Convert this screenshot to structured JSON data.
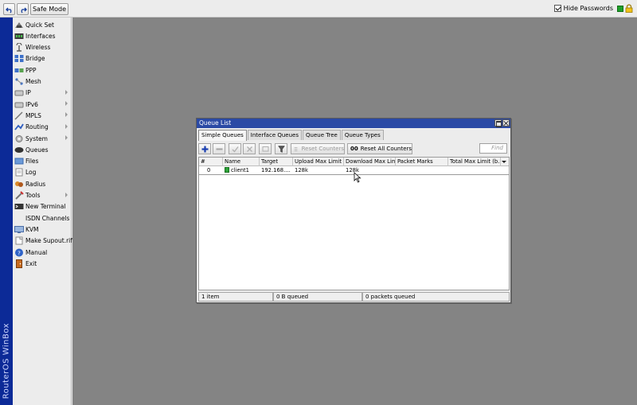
{
  "topbar": {
    "safe_mode_label": "Safe Mode",
    "hide_passwords_label": "Hide Passwords",
    "hide_passwords_checked": true,
    "status_color": "#1fa02a"
  },
  "brand": {
    "text": "RouterOS WinBox",
    "color": "#0c2a97"
  },
  "sidebar": {
    "items": [
      {
        "label": "Quick Set",
        "icon": "quick-set-icon",
        "submenu": false
      },
      {
        "label": "Interfaces",
        "icon": "interfaces-icon",
        "submenu": false
      },
      {
        "label": "Wireless",
        "icon": "wireless-icon",
        "submenu": false
      },
      {
        "label": "Bridge",
        "icon": "bridge-icon",
        "submenu": false
      },
      {
        "label": "PPP",
        "icon": "ppp-icon",
        "submenu": false
      },
      {
        "label": "Mesh",
        "icon": "mesh-icon",
        "submenu": false
      },
      {
        "label": "IP",
        "icon": "ip-icon",
        "submenu": true
      },
      {
        "label": "IPv6",
        "icon": "ipv6-icon",
        "submenu": true
      },
      {
        "label": "MPLS",
        "icon": "mpls-icon",
        "submenu": true
      },
      {
        "label": "Routing",
        "icon": "routing-icon",
        "submenu": true
      },
      {
        "label": "System",
        "icon": "system-icon",
        "submenu": true
      },
      {
        "label": "Queues",
        "icon": "queues-icon",
        "submenu": false
      },
      {
        "label": "Files",
        "icon": "files-icon",
        "submenu": false
      },
      {
        "label": "Log",
        "icon": "log-icon",
        "submenu": false
      },
      {
        "label": "Radius",
        "icon": "radius-icon",
        "submenu": false
      },
      {
        "label": "Tools",
        "icon": "tools-icon",
        "submenu": true
      },
      {
        "label": "New Terminal",
        "icon": "terminal-icon",
        "submenu": false
      },
      {
        "label": "ISDN Channels",
        "icon": "",
        "submenu": false
      },
      {
        "label": "KVM",
        "icon": "kvm-icon",
        "submenu": false
      },
      {
        "label": "Make Supout.rif",
        "icon": "supout-icon",
        "submenu": false
      },
      {
        "label": "Manual",
        "icon": "manual-icon",
        "submenu": false
      },
      {
        "label": "Exit",
        "icon": "exit-icon",
        "submenu": false
      }
    ]
  },
  "window": {
    "title": "Queue List",
    "tabs": [
      "Simple Queues",
      "Interface Queues",
      "Queue Tree",
      "Queue Types"
    ],
    "active_tab": 0,
    "toolbar": {
      "reset_counters_label": "Reset Counters",
      "reset_all_counters_label": "Reset All Counters",
      "find_placeholder": "Find"
    },
    "columns": [
      "#",
      "Name",
      "Target",
      "Upload Max Limit",
      "Download Max Limit",
      "Packet Marks",
      "Total Max Limit (b..."
    ],
    "rows": [
      {
        "num": "0",
        "name": "client1",
        "target": "192.168....",
        "upload": "128k",
        "download": "128k",
        "marks": "",
        "total": ""
      }
    ],
    "status": {
      "items": "1 item",
      "queued_bytes": "0 B queued",
      "queued_packets": "0 packets queued"
    }
  }
}
